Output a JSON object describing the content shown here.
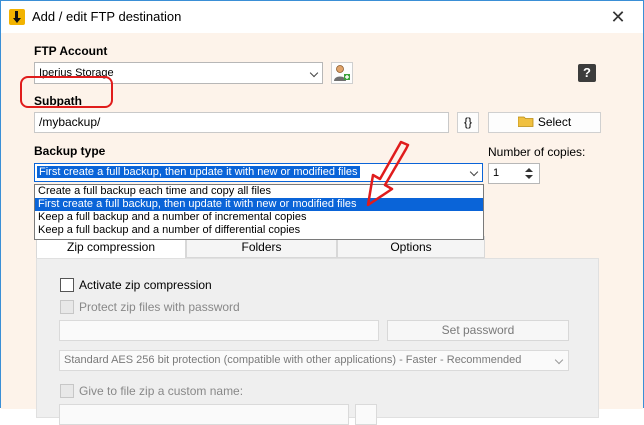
{
  "window": {
    "title": "Add / edit FTP destination"
  },
  "ftp_account": {
    "label": "FTP Account",
    "value": "Iperius Storage"
  },
  "subpath": {
    "label": "Subpath",
    "value": "/mybackup/",
    "vars_button": "{}",
    "select_button": "Select"
  },
  "backup_type": {
    "label": "Backup type",
    "selected": "First create a full backup, then update it with new or modified files",
    "options": [
      "Create a full backup each time and copy all files",
      "First create a full backup, then update it with new or modified files",
      "Keep a full backup and a number of incremental copies",
      "Keep a full backup and a number of differential copies"
    ],
    "highlighted_index": 1
  },
  "copies": {
    "label": "Number of copies:",
    "value": "1"
  },
  "tabs": [
    "Zip compression",
    "Folders",
    "Options"
  ],
  "zip": {
    "activate_label": "Activate zip compression",
    "protect_label": "Protect zip files with password",
    "set_password_button": "Set password",
    "encryption_value": "Standard AES 256 bit protection (compatible with other applications) - Faster - Recommended",
    "custom_name_label": "Give to file zip a custom name:"
  },
  "colors": {
    "accent": "#0a64d8",
    "annotation": "#e01c1c",
    "background": "#fdf3ea"
  },
  "icons": [
    "app-logo-icon",
    "close-icon",
    "add-user-icon",
    "help-icon",
    "folder-icon",
    "chevron-down-icon",
    "annotation-arrow"
  ]
}
